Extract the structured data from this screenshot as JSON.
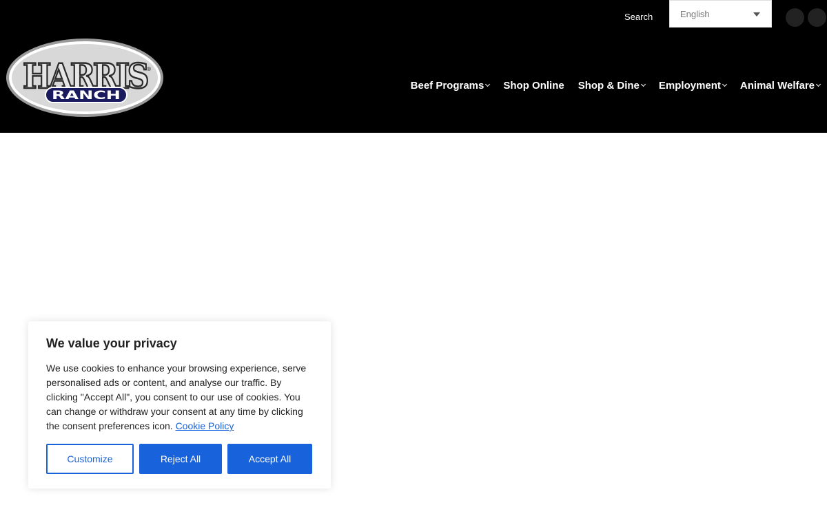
{
  "topbar": {
    "search_label": "Search",
    "language_value": "English"
  },
  "logo": {
    "text_main": "HARRIS",
    "text_sub": "RANCH",
    "registered": "®"
  },
  "nav": [
    {
      "label": "Beef Programs",
      "has_dropdown": true
    },
    {
      "label": "Shop Online",
      "has_dropdown": false
    },
    {
      "label": "Shop & Dine",
      "has_dropdown": true
    },
    {
      "label": "Employment",
      "has_dropdown": true
    },
    {
      "label": "Animal Welfare",
      "has_dropdown": true
    }
  ],
  "cookie": {
    "title": "We value your privacy",
    "body": "We use cookies to enhance your browsing experience, serve personalised ads or content, and analyse our traffic. By clicking \"Accept All\", you consent to our use of cookies. You can change or withdraw your consent at any time by clicking the consent preferences icon. ",
    "policy_link": "Cookie Policy",
    "customize_label": "Customize",
    "reject_label": "Reject All",
    "accept_label": "Accept All"
  },
  "colors": {
    "header_bg": "#000000",
    "accent_blue": "#1863dc"
  }
}
